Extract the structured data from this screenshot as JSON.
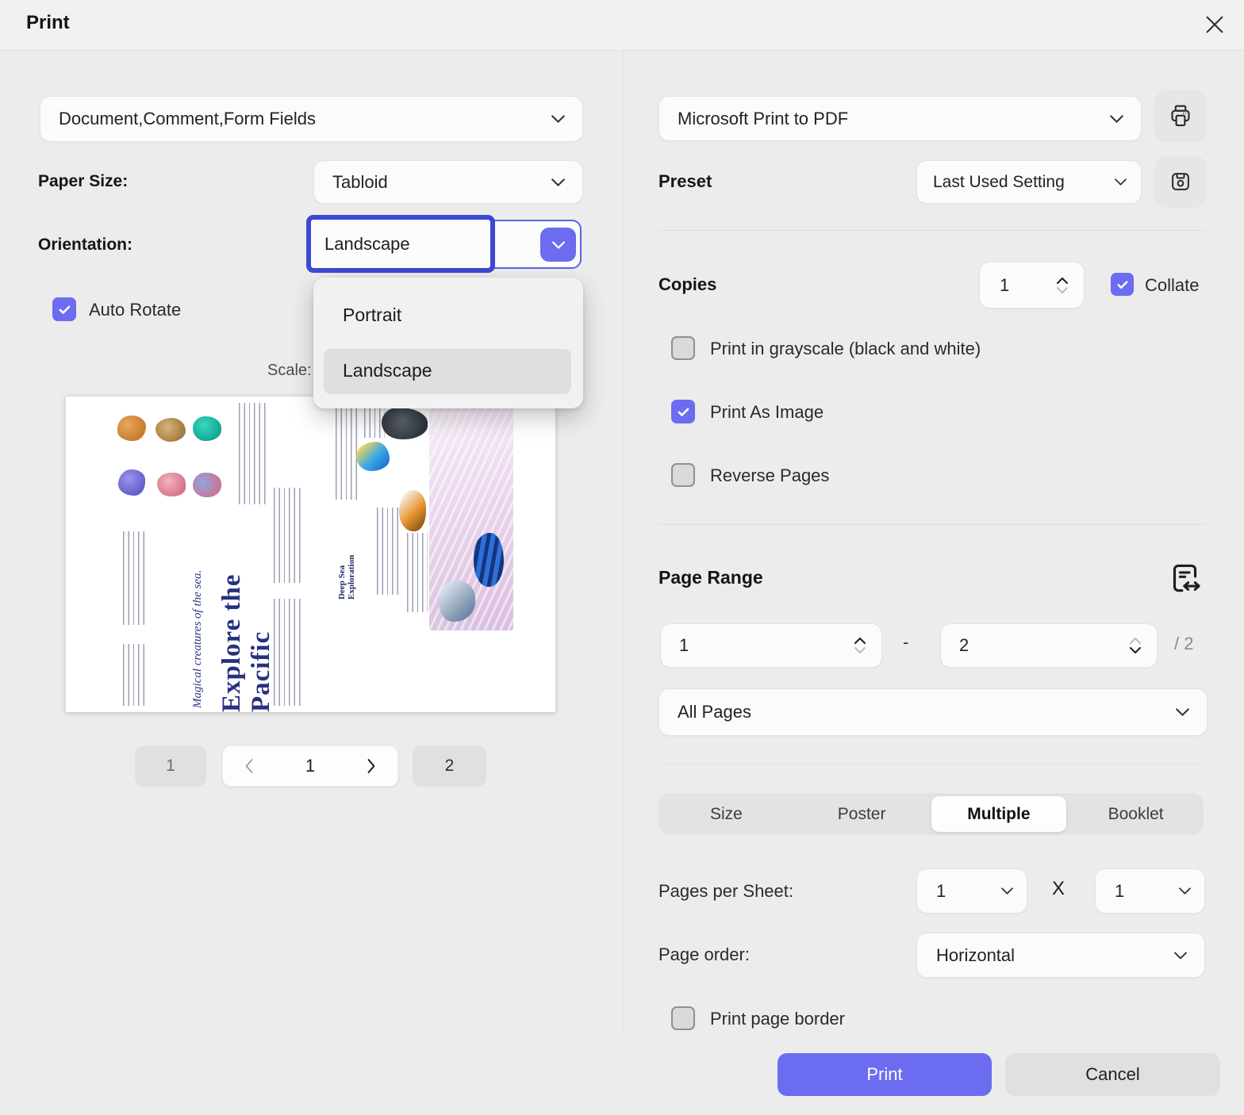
{
  "accent_color": "#6c6cf0",
  "selection_border_color": "#3b49d2",
  "header": {
    "title": "Print"
  },
  "left": {
    "content_select": {
      "value": "Document,Comment,Form Fields"
    },
    "paper_size": {
      "label": "Paper Size:",
      "value": "Tabloid"
    },
    "orientation": {
      "label": "Orientation:",
      "value": "Landscape",
      "options": [
        "Portrait",
        "Landscape"
      ],
      "selected_option": "Landscape"
    },
    "auto_rotate": {
      "label": "Auto Rotate",
      "checked": true
    },
    "scale_label": "Scale:",
    "preview": {
      "kicker": "Magical creatures of the sea.",
      "title": "Explore the Pacific",
      "subhead": "Deep Sea Exploration"
    },
    "pager": {
      "first": "1",
      "current": "1",
      "last": "2"
    }
  },
  "right": {
    "printer_select": {
      "value": "Microsoft Print to PDF"
    },
    "preset": {
      "label": "Preset",
      "value": "Last Used Setting"
    },
    "copies": {
      "label": "Copies",
      "value": "1",
      "collate_label": "Collate",
      "collate_checked": true
    },
    "options": [
      {
        "label": "Print in grayscale (black and white)",
        "checked": false
      },
      {
        "label": "Print As Image",
        "checked": true
      },
      {
        "label": "Reverse Pages",
        "checked": false
      }
    ],
    "page_range": {
      "heading": "Page Range",
      "from": "1",
      "separator": "-",
      "to": "2",
      "total": "/ 2",
      "mode": "All Pages"
    },
    "layout_tabs": {
      "items": [
        "Size",
        "Poster",
        "Multiple",
        "Booklet"
      ],
      "active": "Multiple"
    },
    "pages_per_sheet": {
      "label": "Pages per Sheet:",
      "cols": "1",
      "times": "X",
      "rows": "1"
    },
    "page_order": {
      "label": "Page order:",
      "value": "Horizontal"
    },
    "print_border": {
      "label": "Print page border",
      "checked": false
    },
    "actions": {
      "print": "Print",
      "cancel": "Cancel"
    }
  },
  "icons": {
    "close": "close-icon",
    "chevron_down": "chevron-down-icon",
    "printer": "printer-icon",
    "save_preset": "save-icon",
    "page_range": "page-width-arrows-icon",
    "check": "check-icon",
    "pager_prev": "chevron-left-icon",
    "pager_next": "chevron-right-icon"
  }
}
